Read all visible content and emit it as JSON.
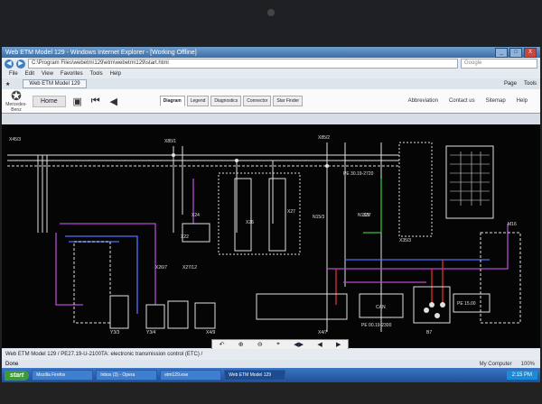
{
  "window": {
    "title": "Web ETM Model 129 - Windows Internet Explorer - [Working Offline]",
    "url": "C:\\Program Files\\webetm\\129\\etm\\webetm\\129\\start.html",
    "search_placeholder": "Google",
    "minimize": "_",
    "maximize": "□",
    "close": "X"
  },
  "menu": [
    "File",
    "Edit",
    "View",
    "Favorites",
    "Tools",
    "Help"
  ],
  "favorites": {
    "tab_label": "Web ETM Model 129",
    "right_items": [
      "Page",
      "Tools"
    ]
  },
  "app": {
    "logo_text": "Mercedes-Benz",
    "home_label": "Home",
    "tabs": [
      "Diagram",
      "Legend",
      "Diagnostics",
      "Connector",
      "Star Finder"
    ],
    "active_tab": "Diagram",
    "links": [
      "Abbreviation",
      "Contact us",
      "Sitemap",
      "Help"
    ]
  },
  "zoom_tools": [
    "↶",
    "⊕",
    "⊖",
    "⌖",
    "◀▶",
    "◀",
    "▶"
  ],
  "status": {
    "text": "Web ETM Model 129 / PE27.19-U-2100TA: electronic transmission control (ETC) /",
    "done": "Done",
    "zone": "My Computer",
    "zoom": "100%"
  },
  "taskbar": {
    "start": "start",
    "items": [
      "Mozilla Firefox",
      "Inbox (3) - Opera",
      "etm129.exe",
      "Web ETM Model 129"
    ],
    "clock": "2:15 PM"
  },
  "diagram_labels": {
    "top_left": "X45/3",
    "labels": [
      "X85/1",
      "X85/2",
      "X27",
      "X26",
      "X24",
      "X22",
      "X26/7",
      "X27/12",
      "N15/3",
      "N15/5",
      "M16",
      "B7",
      "X4/7",
      "X4/9",
      "Y3/3",
      "Y3/4",
      "X35/3",
      "Z37",
      "CAN"
    ],
    "boxes": [
      "PE 30.19-2720",
      "PE 00.19-2300",
      "PE 15.00"
    ]
  },
  "colors": {
    "title_blue": "#3b6ea5",
    "diagram_bg": "#050505",
    "wire_white": "#e0e0e0",
    "wire_purple": "#b04ad0",
    "wire_blue": "#4f6fff",
    "wire_red": "#e03030",
    "wire_green": "#30c040"
  }
}
